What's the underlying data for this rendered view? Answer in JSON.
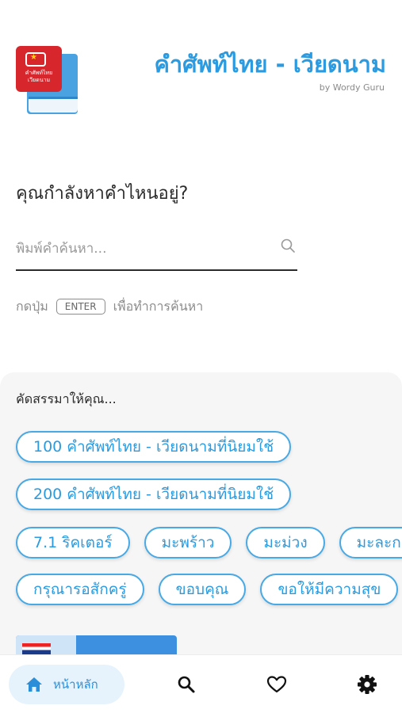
{
  "header": {
    "title": "คำศัพท์ไทย - เวียดนาม",
    "subtitle": "by Wordy Guru",
    "logo_text_line1": "คำศัพท์ไทย",
    "logo_text_line2": "เวียดนาม"
  },
  "search": {
    "question": "คุณกำลังหาคำไหนอยู่?",
    "placeholder": "พิมพ์คำค้นหา...",
    "hint_prefix": "กดปุ่ม",
    "hint_key": "ENTER",
    "hint_suffix": "เพื่อทำการค้นหา"
  },
  "suggestions": {
    "title": "คัดสรรมาให้คุณ...",
    "row1": [
      "100 คำศัพท์ไทย - เวียดนามที่นิยมใช้"
    ],
    "row2": [
      "200 คำศัพท์ไทย - เวียดนามที่นิยมใช้"
    ],
    "row3": [
      "7.1 ริคเตอร์",
      "มะพร้าว",
      "มะม่วง",
      "มะละกอ"
    ],
    "row4": [
      "กรุณารอสักครู่",
      "ขอบคุณ",
      "ขอให้มีความสุข"
    ]
  },
  "nav": {
    "home_label": "หน้าหลัก",
    "accent": "#2a9be0",
    "icons": [
      "home-icon",
      "search-icon",
      "heart-icon",
      "settings-icon"
    ]
  }
}
